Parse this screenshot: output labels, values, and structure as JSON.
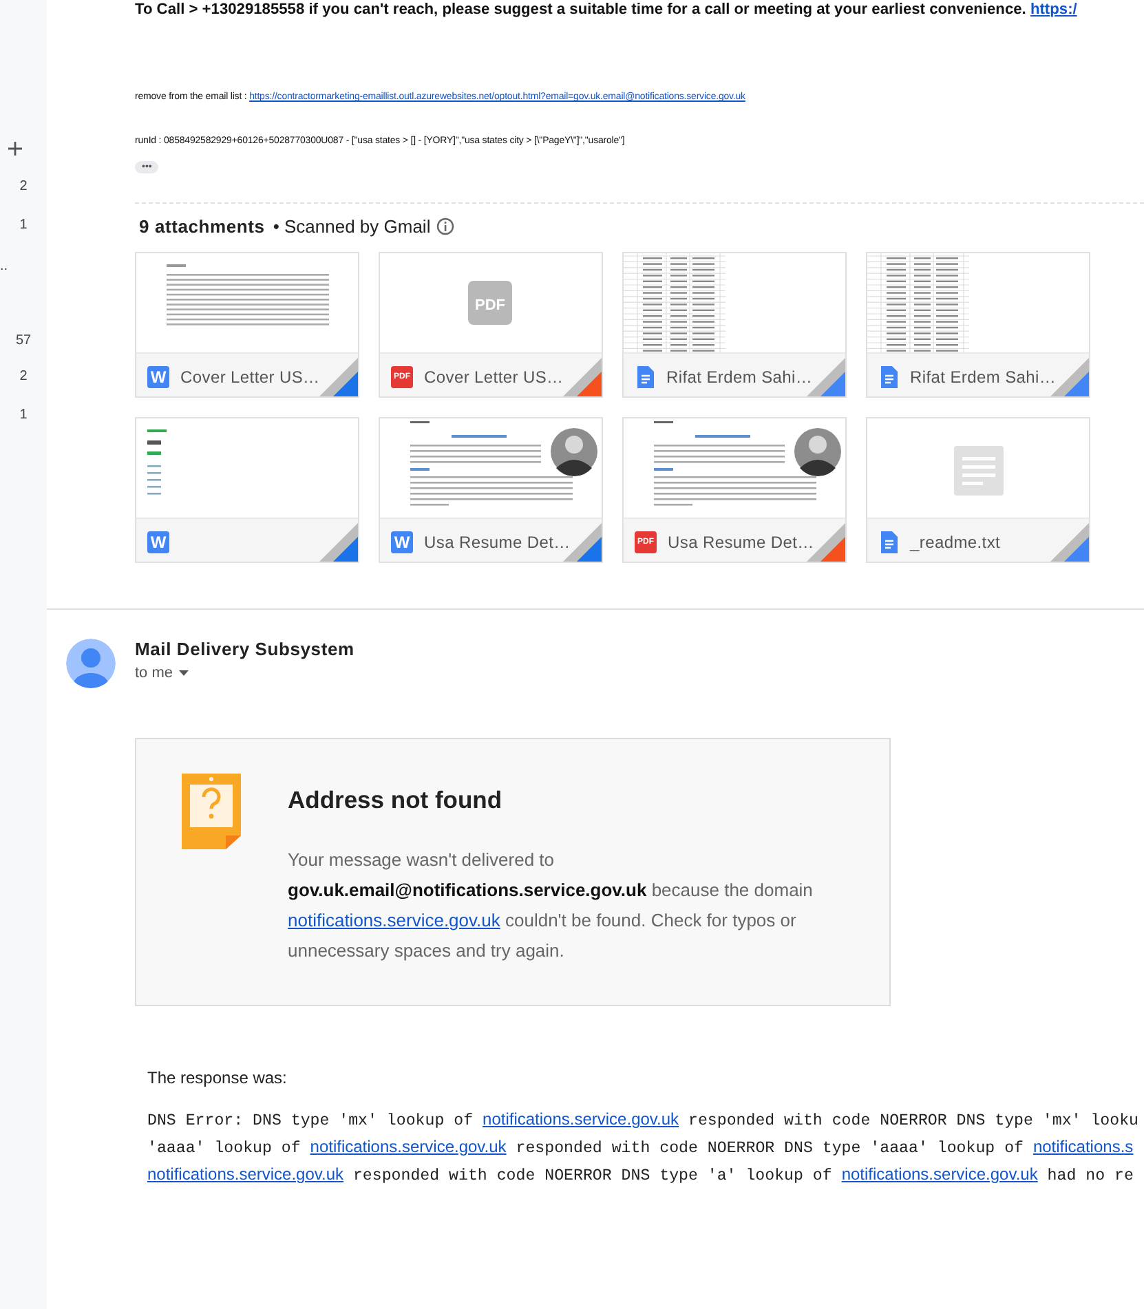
{
  "sidebar": {
    "counts": [
      "2",
      "1",
      "..",
      "57",
      "2",
      "1"
    ]
  },
  "message_body": {
    "call_line": "To Call > +13029185558 if you can't reach, please suggest a suitable time for a call or meeting at your earliest convenience.",
    "call_link": "https:/",
    "remove_label": "remove from the email list :",
    "remove_link": "https://contractormarketing-emaillist.outl.azurewebsites.net/optout.html?email=gov.uk.email@notifications.service.gov.uk",
    "run_id": "runId : 0858492582929+60126+5028770300U087 - [\"usa states > [] - [YORY]\",\"usa states city > [\\\"PageY\\\"]\",\"usarole\"]",
    "more_button": "•••"
  },
  "attachments": {
    "count_label": "9 attachments",
    "scan_label": "• Scanned by Gmail",
    "items": [
      {
        "kind": "word",
        "badge": "W",
        "preview": {
          "kind": "text"
        },
        "name": "Cover Letter US…"
      },
      {
        "kind": "pdf",
        "badge": "PDF",
        "preview": {
          "kind": "placeholder",
          "label": "PDF"
        },
        "name": "Cover Letter US…"
      },
      {
        "kind": "gdoc",
        "preview": {
          "kind": "sheet"
        },
        "name": "Rifat Erdem Sahi…"
      },
      {
        "kind": "gdoc",
        "preview": {
          "kind": "sheet"
        },
        "name": "Rifat Erdem Sahi…"
      },
      {
        "kind": "word",
        "badge": "W",
        "preview": {
          "kind": "partial"
        }
      },
      {
        "kind": "word",
        "badge": "W",
        "preview": {
          "kind": "resume"
        },
        "name": "Usa Resume Det…"
      },
      {
        "kind": "pdf",
        "badge": "PDF",
        "preview": {
          "kind": "resume"
        },
        "name": "Usa Resume Det…"
      },
      {
        "kind": "gdoc",
        "preview": {
          "kind": "lines"
        },
        "name": "_readme.txt"
      }
    ]
  },
  "bounce": {
    "sender": "Mail Delivery Subsystem",
    "recipient": "to me",
    "title": "Address not found",
    "message": "Your message wasn't delivered to **gov.uk.email@notifications.service.gov.uk** because the domain",
    "domain_link": "notifications.service.gov.uk",
    "message_end": "couldn't be found. Check for typos or unnecessary spaces and try again.",
    "response_label": "The response was:",
    "error_lines": [
      [
        {
          "text": "DNS Error: DNS type 'mx' lookup of "
        },
        {
          "link": "notifications.service.gov.uk"
        },
        {
          "text": " responded with code NOERROR DNS type 'mx' looku"
        }
      ],
      [
        {
          "text": "'aaaa' lookup of "
        },
        {
          "link": "notifications.service.gov.uk"
        },
        {
          "text": " responded with code NOERROR DNS type 'aaaa' lookup of "
        },
        {
          "link": "notifications.s"
        }
      ],
      [
        {
          "link": "notifications.service.gov.uk"
        },
        {
          "text": " responded with code NOERROR DNS type 'a' lookup of "
        },
        {
          "link": "notifications.service.gov.uk"
        },
        {
          "text": " had no re"
        }
      ]
    ]
  }
}
